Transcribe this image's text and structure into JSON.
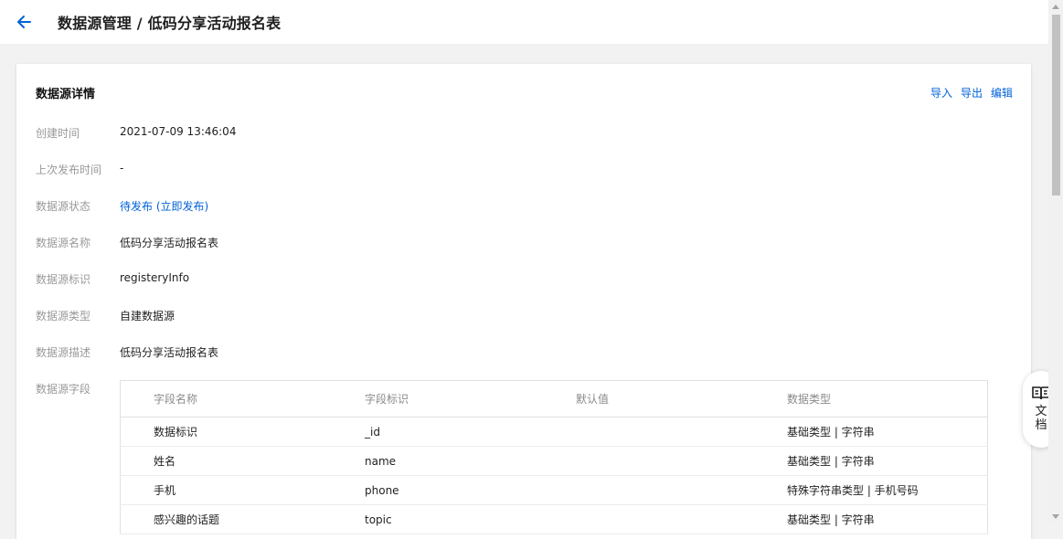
{
  "header": {
    "title": "数据源管理 / 低码分享活动报名表"
  },
  "card": {
    "title": "数据源详情",
    "actions": [
      "导入",
      "导出",
      "编辑"
    ]
  },
  "details": [
    {
      "label": "创建时间",
      "value": "2021-07-09 13:46:04"
    },
    {
      "label": "上次发布时间",
      "value": "-"
    },
    {
      "label": "数据源状态",
      "value": "待发布 (立即发布)"
    },
    {
      "label": "数据源名称",
      "value": "低码分享活动报名表"
    },
    {
      "label": "数据源标识",
      "value": "registeryInfo"
    },
    {
      "label": "数据源类型",
      "value": "自建数据源"
    },
    {
      "label": "数据源描述",
      "value": "低码分享活动报名表"
    },
    {
      "label": "数据源字段",
      "value": ""
    }
  ],
  "fields_table": {
    "columns": [
      "字段名称",
      "字段标识",
      "默认值",
      "数据类型"
    ],
    "rows": [
      [
        "数据标识",
        "_id",
        "",
        "基础类型 | 字符串"
      ],
      [
        "姓名",
        "name",
        "",
        "基础类型 | 字符串"
      ],
      [
        "手机",
        "phone",
        "",
        "特殊字符串类型 | 手机号码"
      ],
      [
        "感兴趣的话题",
        "topic",
        "",
        "基础类型 | 字符串"
      ]
    ]
  },
  "doc_button": {
    "label": "文档"
  },
  "colors": {
    "accent": "#0062d6",
    "label": "#999999",
    "background": "#f2f2f2"
  }
}
